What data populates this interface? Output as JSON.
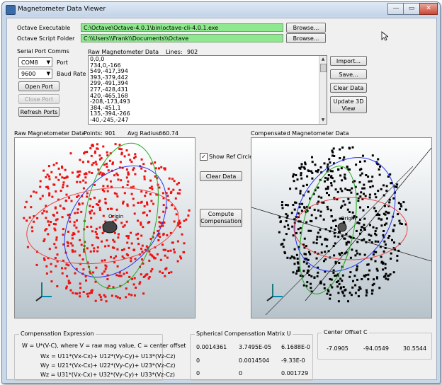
{
  "window": {
    "title": "Magnetometer Data Viewer",
    "min": "—",
    "max": "▭",
    "close": "✕"
  },
  "paths": {
    "octave_exe_label": "Octave Executable",
    "octave_exe_value": "C:\\Octave\\Octave-4.0.1\\bin\\octave-cli-4.0.1.exe",
    "script_folder_label": "Octave Script Folder",
    "script_folder_value": "C:\\\\Users\\\\Frank\\\\Documents\\\\Octave",
    "browse_label": "Browse..."
  },
  "serial": {
    "group_label": "Serial Port Comms",
    "port_value": "COM8",
    "port_label": "Port",
    "baud_value": "9600",
    "baud_label": "Baud Rate",
    "open_label": "Open Port",
    "close_label": "Close Port",
    "refresh_label": "Refresh Ports"
  },
  "raw_data": {
    "label": "Raw Magnetometer Data",
    "lines_label": "Lines:",
    "lines_value": "902",
    "rows": [
      "0,0,0",
      "734,0,-166",
      "549,-417,394",
      "393,-379,442",
      "299,-491,394",
      "277,-428,431",
      "420,-465,168",
      "-208,-173,493",
      "384,-451,1",
      "135,-394,-266",
      "-40,-245,-247",
      "-124,37,-202"
    ]
  },
  "right_buttons": {
    "import": "Import...",
    "save": "Save...",
    "clear": "Clear Data",
    "update3d": "Update 3D View"
  },
  "raw_view": {
    "label": "Raw Magnetometer Data",
    "points_label": "Points:",
    "points_value": "901",
    "radius_label": "Avg Radius:",
    "radius_value": "660.74",
    "origin": "Origin",
    "point_color": "#ee1111"
  },
  "middle": {
    "show_ref_label": "Show Ref Circles",
    "show_ref_checked": true,
    "clear_label": "Clear Data",
    "compute_label": "Compute Compensation"
  },
  "comp_view": {
    "label": "Compensated Magnetometer Data",
    "origin": "Origin",
    "point_color": "#000000"
  },
  "comp_expr": {
    "label": "Compensation Expression",
    "line0": "W = U*(V-C), where V = raw mag value, C = center offset",
    "line1": "Wx = U11*(Vx-Cx)+ U12*(Vy-Cy)+ U13*(Vz-Cz)",
    "line2": "Wy = U21*(Vx-Cx)+ U22*(Vy-Cy)+ U23*(Vz-Cz)",
    "line3": "Wz = U31*(Vx-Cx)+ U32*(Vy-Cy)+ U33*(Vz-Cz)"
  },
  "matrix": {
    "label": "Spherical Compensation Matrix U",
    "r0": [
      "0.0014361",
      "3.7495E-05",
      "6.1688E-0"
    ],
    "r1": [
      "0",
      "0.0014504",
      "-9.33E-0"
    ],
    "r2": [
      "0",
      "0",
      "0.001729"
    ]
  },
  "center": {
    "label": "Center Offset C",
    "cx": "-7.0905",
    "cy": "-94.0549",
    "cz": "30.5544"
  }
}
